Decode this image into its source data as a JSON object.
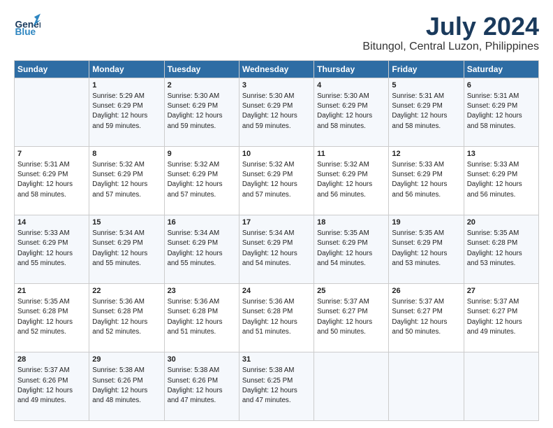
{
  "header": {
    "logo_general": "General",
    "logo_blue": "Blue",
    "title": "July 2024",
    "subtitle": "Bitungol, Central Luzon, Philippines"
  },
  "days_of_week": [
    "Sunday",
    "Monday",
    "Tuesday",
    "Wednesday",
    "Thursday",
    "Friday",
    "Saturday"
  ],
  "weeks": [
    [
      {
        "day": "",
        "content": ""
      },
      {
        "day": "1",
        "content": "Sunrise: 5:29 AM\nSunset: 6:29 PM\nDaylight: 12 hours\nand 59 minutes."
      },
      {
        "day": "2",
        "content": "Sunrise: 5:30 AM\nSunset: 6:29 PM\nDaylight: 12 hours\nand 59 minutes."
      },
      {
        "day": "3",
        "content": "Sunrise: 5:30 AM\nSunset: 6:29 PM\nDaylight: 12 hours\nand 59 minutes."
      },
      {
        "day": "4",
        "content": "Sunrise: 5:30 AM\nSunset: 6:29 PM\nDaylight: 12 hours\nand 58 minutes."
      },
      {
        "day": "5",
        "content": "Sunrise: 5:31 AM\nSunset: 6:29 PM\nDaylight: 12 hours\nand 58 minutes."
      },
      {
        "day": "6",
        "content": "Sunrise: 5:31 AM\nSunset: 6:29 PM\nDaylight: 12 hours\nand 58 minutes."
      }
    ],
    [
      {
        "day": "7",
        "content": "Sunrise: 5:31 AM\nSunset: 6:29 PM\nDaylight: 12 hours\nand 58 minutes."
      },
      {
        "day": "8",
        "content": "Sunrise: 5:32 AM\nSunset: 6:29 PM\nDaylight: 12 hours\nand 57 minutes."
      },
      {
        "day": "9",
        "content": "Sunrise: 5:32 AM\nSunset: 6:29 PM\nDaylight: 12 hours\nand 57 minutes."
      },
      {
        "day": "10",
        "content": "Sunrise: 5:32 AM\nSunset: 6:29 PM\nDaylight: 12 hours\nand 57 minutes."
      },
      {
        "day": "11",
        "content": "Sunrise: 5:32 AM\nSunset: 6:29 PM\nDaylight: 12 hours\nand 56 minutes."
      },
      {
        "day": "12",
        "content": "Sunrise: 5:33 AM\nSunset: 6:29 PM\nDaylight: 12 hours\nand 56 minutes."
      },
      {
        "day": "13",
        "content": "Sunrise: 5:33 AM\nSunset: 6:29 PM\nDaylight: 12 hours\nand 56 minutes."
      }
    ],
    [
      {
        "day": "14",
        "content": "Sunrise: 5:33 AM\nSunset: 6:29 PM\nDaylight: 12 hours\nand 55 minutes."
      },
      {
        "day": "15",
        "content": "Sunrise: 5:34 AM\nSunset: 6:29 PM\nDaylight: 12 hours\nand 55 minutes."
      },
      {
        "day": "16",
        "content": "Sunrise: 5:34 AM\nSunset: 6:29 PM\nDaylight: 12 hours\nand 55 minutes."
      },
      {
        "day": "17",
        "content": "Sunrise: 5:34 AM\nSunset: 6:29 PM\nDaylight: 12 hours\nand 54 minutes."
      },
      {
        "day": "18",
        "content": "Sunrise: 5:35 AM\nSunset: 6:29 PM\nDaylight: 12 hours\nand 54 minutes."
      },
      {
        "day": "19",
        "content": "Sunrise: 5:35 AM\nSunset: 6:29 PM\nDaylight: 12 hours\nand 53 minutes."
      },
      {
        "day": "20",
        "content": "Sunrise: 5:35 AM\nSunset: 6:28 PM\nDaylight: 12 hours\nand 53 minutes."
      }
    ],
    [
      {
        "day": "21",
        "content": "Sunrise: 5:35 AM\nSunset: 6:28 PM\nDaylight: 12 hours\nand 52 minutes."
      },
      {
        "day": "22",
        "content": "Sunrise: 5:36 AM\nSunset: 6:28 PM\nDaylight: 12 hours\nand 52 minutes."
      },
      {
        "day": "23",
        "content": "Sunrise: 5:36 AM\nSunset: 6:28 PM\nDaylight: 12 hours\nand 51 minutes."
      },
      {
        "day": "24",
        "content": "Sunrise: 5:36 AM\nSunset: 6:28 PM\nDaylight: 12 hours\nand 51 minutes."
      },
      {
        "day": "25",
        "content": "Sunrise: 5:37 AM\nSunset: 6:27 PM\nDaylight: 12 hours\nand 50 minutes."
      },
      {
        "day": "26",
        "content": "Sunrise: 5:37 AM\nSunset: 6:27 PM\nDaylight: 12 hours\nand 50 minutes."
      },
      {
        "day": "27",
        "content": "Sunrise: 5:37 AM\nSunset: 6:27 PM\nDaylight: 12 hours\nand 49 minutes."
      }
    ],
    [
      {
        "day": "28",
        "content": "Sunrise: 5:37 AM\nSunset: 6:26 PM\nDaylight: 12 hours\nand 49 minutes."
      },
      {
        "day": "29",
        "content": "Sunrise: 5:38 AM\nSunset: 6:26 PM\nDaylight: 12 hours\nand 48 minutes."
      },
      {
        "day": "30",
        "content": "Sunrise: 5:38 AM\nSunset: 6:26 PM\nDaylight: 12 hours\nand 47 minutes."
      },
      {
        "day": "31",
        "content": "Sunrise: 5:38 AM\nSunset: 6:25 PM\nDaylight: 12 hours\nand 47 minutes."
      },
      {
        "day": "",
        "content": ""
      },
      {
        "day": "",
        "content": ""
      },
      {
        "day": "",
        "content": ""
      }
    ]
  ]
}
